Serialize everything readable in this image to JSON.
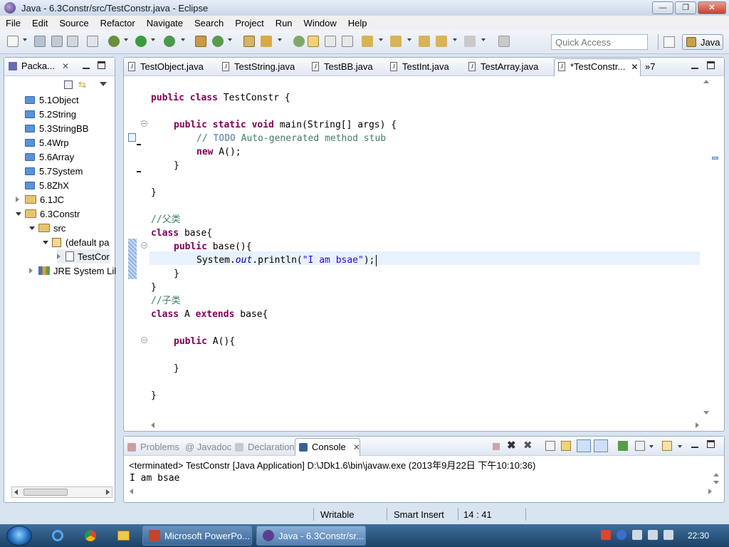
{
  "window": {
    "title": "Java - 6.3Constr/src/TestConstr.java - Eclipse",
    "minimize": "—",
    "maximize": "❐",
    "close": "✕"
  },
  "menu": [
    "File",
    "Edit",
    "Source",
    "Refactor",
    "Navigate",
    "Search",
    "Project",
    "Run",
    "Window",
    "Help"
  ],
  "toolbar": {
    "quick_access_placeholder": "Quick Access",
    "perspective_label": "Java"
  },
  "package_explorer": {
    "tab_label": "Packa...",
    "items": [
      {
        "label": "5.1Object"
      },
      {
        "label": "5.2String"
      },
      {
        "label": "5.3StringBB"
      },
      {
        "label": "5.4Wrp"
      },
      {
        "label": "5.6Array"
      },
      {
        "label": "5.7System"
      },
      {
        "label": "5.8ZhX"
      },
      {
        "label": "6.1JC"
      },
      {
        "label": "6.3Constr"
      },
      {
        "label": "src"
      },
      {
        "label": "(default pa"
      },
      {
        "label": "TestCor"
      },
      {
        "label": "JRE System Lil"
      }
    ]
  },
  "editor": {
    "tabs": [
      {
        "label": "TestObject.java"
      },
      {
        "label": "TestString.java"
      },
      {
        "label": "TestBB.java"
      },
      {
        "label": "TestInt.java"
      },
      {
        "label": "TestArray.java"
      },
      {
        "label": "*TestConstr..."
      }
    ],
    "overflow_label": "»7",
    "code": {
      "l1_kw": "public class",
      "l1_rest": " TestConstr {",
      "l2_kw": "public static void",
      "l2_rest": " main(String[] args) {",
      "l3_cm1": "// ",
      "l3_todo": "TODO",
      "l3_cm2": " Auto-generated method stub",
      "l4_kw": "new",
      "l4_rest": " A();",
      "l5": "}",
      "l6": "}",
      "l7_cm": "//父类",
      "l8_kw": "class",
      "l8_rest": " base{",
      "l9_kw": "public",
      "l9_rest": " base(){",
      "l10_a": "System.",
      "l10_fld": "out",
      "l10_b": ".println(",
      "l10_str": "\"I am bsae\"",
      "l10_c": ");",
      "l11": "}",
      "l12": "}",
      "l13_cm": "//子类",
      "l14_kw1": "class",
      "l14_mid": " A ",
      "l14_kw2": "extends",
      "l14_rest": " base{",
      "l15_kw": "public",
      "l15_rest": " A(){",
      "l16": "}",
      "l17": "}"
    }
  },
  "console": {
    "tabs": [
      {
        "label": "Problems"
      },
      {
        "label": "@ Javadoc"
      },
      {
        "label": "Declaration"
      },
      {
        "label": "Console"
      }
    ],
    "status": "<terminated> TestConstr [Java Application] D:\\JDk1.6\\bin\\javaw.exe (2013年9月22日 下午10:10:36)",
    "output": "I am bsae"
  },
  "statusbar": {
    "writable": "Writable",
    "insert_mode": "Smart Insert",
    "position": "14 : 41"
  },
  "taskbar": {
    "tasks": [
      {
        "label": "Microsoft PowerPo..."
      },
      {
        "label": "Java - 6.3Constr/sr..."
      }
    ],
    "clock": "22:30"
  },
  "colors": {
    "keyword": "#7f0055",
    "comment": "#3f7f5f",
    "string": "#2a00ff",
    "field": "#0000c0",
    "current_line": "#e8f2fe"
  }
}
